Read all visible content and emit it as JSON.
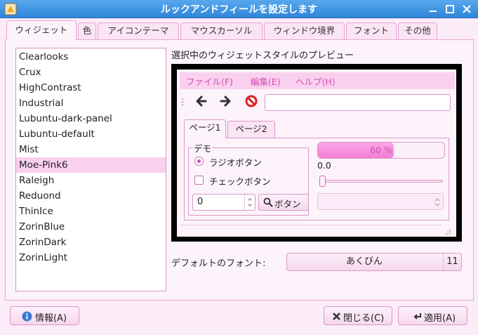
{
  "window": {
    "title": "ルックアンドフィールを設定します"
  },
  "tabs": [
    {
      "label": "ウィジェット"
    },
    {
      "label": "色"
    },
    {
      "label": "アイコンテーマ"
    },
    {
      "label": "マウスカーソル"
    },
    {
      "label": "ウィンドウ境界"
    },
    {
      "label": "フォント"
    },
    {
      "label": "その他"
    }
  ],
  "themes": {
    "items": [
      "Clearlooks",
      "Crux",
      "HighContrast",
      "Industrial",
      "Lubuntu-dark-panel",
      "Lubuntu-default",
      "Mist",
      "Moe-Pink6",
      "Raleigh",
      "Reduond",
      "ThinIce",
      "ZorinBlue",
      "ZorinDark",
      "ZorinLight"
    ],
    "selected": "Moe-Pink6"
  },
  "preview": {
    "label": "選択中のウィジェットスタイルのプレビュー",
    "menu": [
      "ファイル(F)",
      "編集(E)",
      "ヘルプ(H)"
    ],
    "tabs": [
      "ページ1",
      "ページ2"
    ],
    "group_title": "デモ",
    "radio_label": "ラジオボタン",
    "check_label": "チェックボタン",
    "spin_value": "0",
    "button_label": "ボタン",
    "progress_text": "60 %",
    "progress_value": 0.6,
    "scale_value": "0.0"
  },
  "font": {
    "label": "デフォルトのフォント:",
    "name": "あくびん",
    "size": "11"
  },
  "buttons": {
    "about": "情報(A)",
    "close": "閉じる(C)",
    "apply": "適用(A)"
  },
  "colors": {
    "titlebar": "#2f86d8",
    "accent": "#d24fb4",
    "selection": "#fad0ef"
  }
}
